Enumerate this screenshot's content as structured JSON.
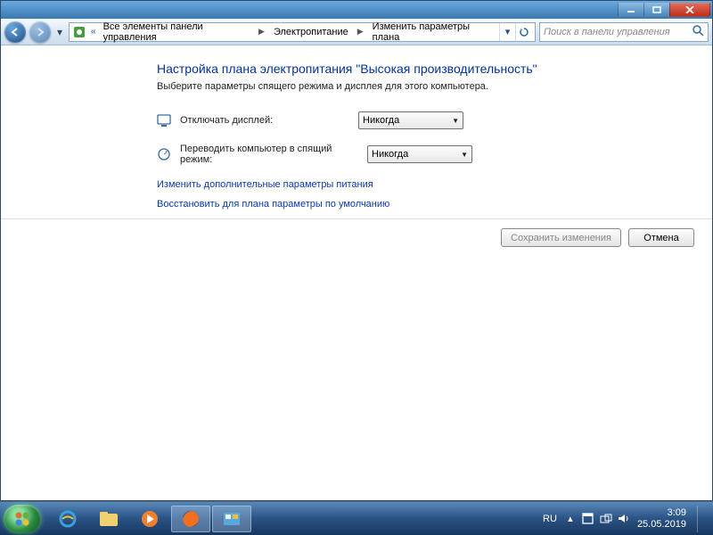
{
  "breadcrumb": {
    "items": [
      "Все элементы панели управления",
      "Электропитание",
      "Изменить параметры плана"
    ]
  },
  "search": {
    "placeholder": "Поиск в панели управления"
  },
  "page": {
    "title": "Настройка плана электропитания \"Высокая производительность\"",
    "subtitle": "Выберите параметры спящего режима и дисплея для этого компьютера."
  },
  "settings": {
    "turn_off_display": {
      "label": "Отключать дисплей:",
      "value": "Никогда"
    },
    "sleep": {
      "label": "Переводить компьютер в спящий режим:",
      "value": "Никогда"
    }
  },
  "links": {
    "advanced": "Изменить дополнительные параметры питания",
    "restore": "Восстановить для плана параметры по умолчанию"
  },
  "buttons": {
    "save": "Сохранить изменения",
    "cancel": "Отмена"
  },
  "taskbar": {
    "lang": "RU",
    "time": "3:09",
    "date": "25.05.2019"
  }
}
